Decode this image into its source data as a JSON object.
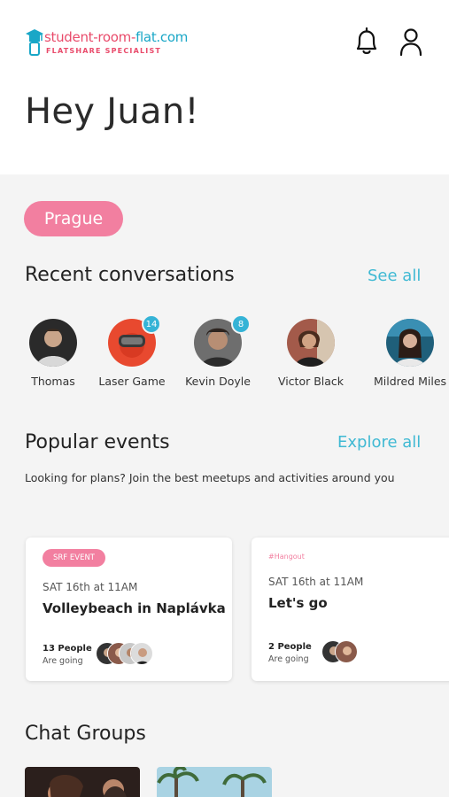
{
  "header": {
    "logo_name_pre": "student-room-",
    "logo_name_post": "flat.com",
    "logo_tagline": "FLATSHARE SPECIALIST",
    "notifications_icon": "bell-icon",
    "profile_icon": "user-icon"
  },
  "greeting": "Hey Juan!",
  "city": "Prague",
  "recent": {
    "title": "Recent conversations",
    "see_all": "See all",
    "items": [
      {
        "label": "Thomas",
        "badge": ""
      },
      {
        "label": "Laser Game",
        "badge": "14"
      },
      {
        "label": "Kevin Doyle",
        "badge": "8"
      },
      {
        "label": "Victor Black",
        "badge": ""
      },
      {
        "label": "Mildred Miles",
        "badge": ""
      }
    ]
  },
  "events": {
    "title": "Popular events",
    "explore_all": "Explore all",
    "subtitle": "Looking for plans? Join the best meetups and activities around you",
    "cards": [
      {
        "tag": "SRF EVENT",
        "date": "SAT 16th at 11AM",
        "title": "Volleybeach in Naplávka",
        "count": "13 People",
        "going": "Are going"
      },
      {
        "tag": "#Hangout",
        "date": "SAT 16th at 11AM",
        "title": "Let's go",
        "count": "2 People",
        "going": "Are going"
      }
    ]
  },
  "chat_groups": {
    "title": "Chat Groups"
  },
  "colors": {
    "accent_pink": "#f27fa0",
    "accent_teal": "#3fb9d3",
    "badge_blue": "#35b3d6"
  }
}
